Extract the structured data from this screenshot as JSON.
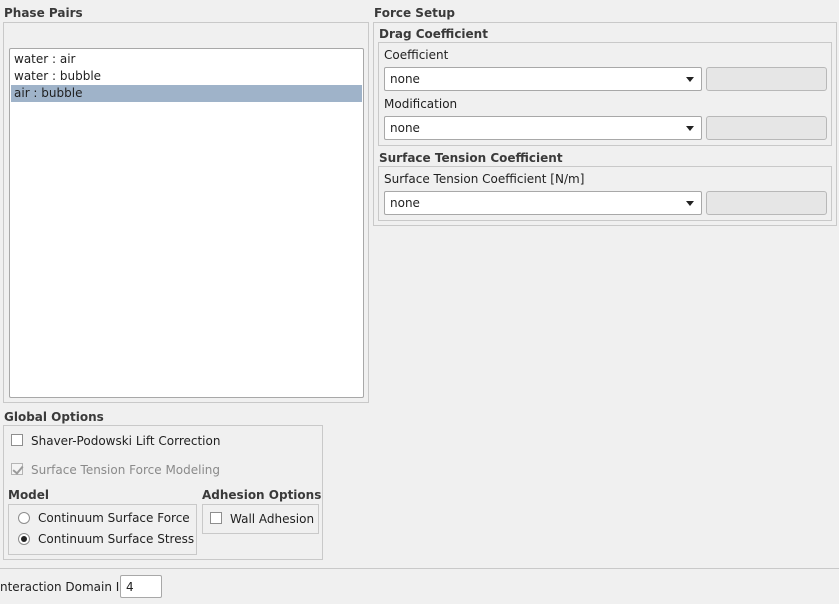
{
  "phase_pairs": {
    "title": "Phase Pairs",
    "items": [
      {
        "label": "water : air",
        "selected": false
      },
      {
        "label": "water : bubble",
        "selected": false
      },
      {
        "label": "air : bubble",
        "selected": true
      }
    ]
  },
  "force_setup": {
    "title": "Force Setup",
    "drag": {
      "title": "Drag Coefficient",
      "coefficient_label": "Coefficient",
      "coefficient_value": "none",
      "modification_label": "Modification",
      "modification_value": "none"
    },
    "surface_tension": {
      "title": "Surface Tension Coefficient",
      "field_label": "Surface Tension Coefficient [N/m]",
      "field_value": "none"
    }
  },
  "global_options": {
    "title": "Global Options",
    "lift_correction": {
      "label": "Shaver-Podowski Lift Correction",
      "checked": false
    },
    "surface_tension_modeling": {
      "label": "Surface Tension Force Modeling",
      "checked": true,
      "disabled": true
    },
    "model": {
      "title": "Model",
      "options": [
        {
          "label": "Continuum Surface Force",
          "selected": false
        },
        {
          "label": "Continuum Surface Stress",
          "selected": true
        }
      ]
    },
    "adhesion": {
      "title": "Adhesion Options",
      "wall_adhesion": {
        "label": "Wall Adhesion",
        "checked": false
      }
    }
  },
  "interaction_domain": {
    "label": "nteraction Domain ID",
    "value": "4"
  }
}
